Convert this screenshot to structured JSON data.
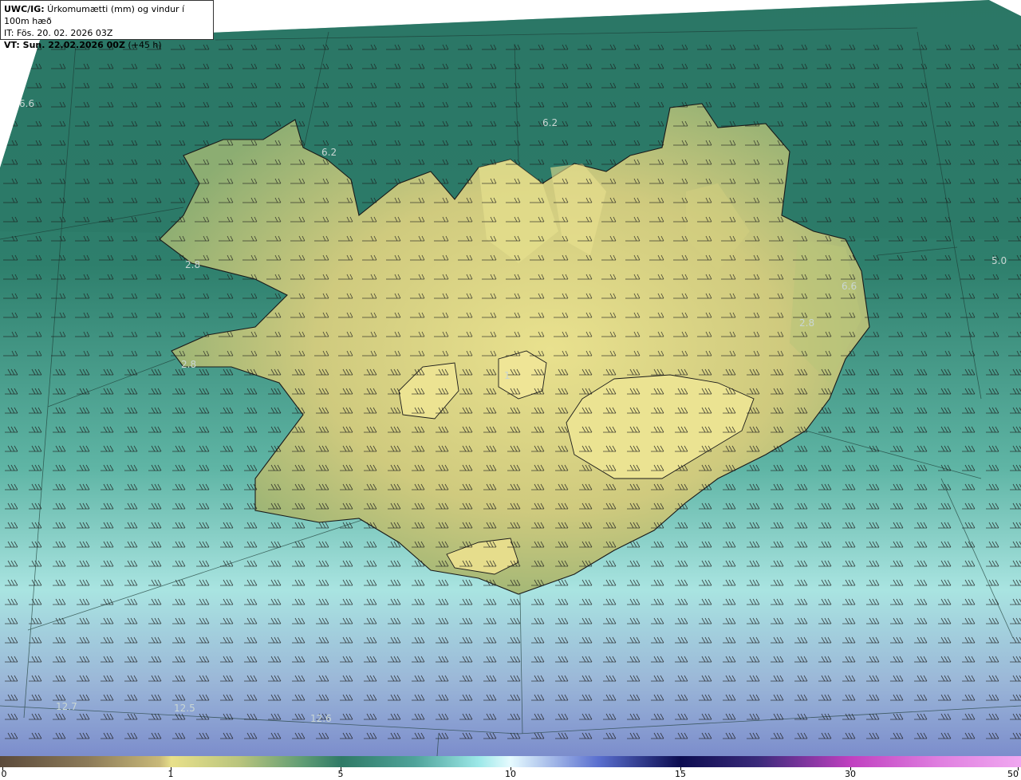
{
  "header": {
    "line1_prefix": "UWC/IG:",
    "line1_text": " Úrkomumætti (mm) og vindur í 100m hæð",
    "line2": "IT: Fös. 20. 02. 2026 03Z",
    "line3_prefix": "VT: Sun. 22.02.2026 00Z",
    "line3_text": " (+45 h)"
  },
  "map_labels": [
    {
      "id": "label-w-top",
      "text": "6.6"
    },
    {
      "id": "label-westfjords",
      "text": "6.2"
    },
    {
      "id": "label-north",
      "text": "6.2"
    },
    {
      "id": "label-east-sea",
      "text": "5.0"
    },
    {
      "id": "label-east-coast",
      "text": "6.6"
    },
    {
      "id": "label-east-inland",
      "text": "2.8"
    },
    {
      "id": "label-west-inland",
      "text": "2.8"
    },
    {
      "id": "label-snaefells",
      "text": "2.8"
    },
    {
      "id": "label-center",
      "text": "1"
    },
    {
      "id": "label-sw-sea",
      "text": "12.7"
    },
    {
      "id": "label-s-sea-1",
      "text": "12.5"
    },
    {
      "id": "label-s-sea-2",
      "text": "12.6"
    }
  ],
  "colorbar": {
    "ticks": [
      "0",
      "1",
      "5",
      "10",
      "15",
      "30",
      "50"
    ],
    "colors": [
      "#5b4a3b",
      "#b0a070",
      "#e8e08a",
      "#2f7a66",
      "#9ce8e8",
      "#e6fbff",
      "#2a2a8a",
      "#0c0c50",
      "#c040c0",
      "#f0a8f0"
    ]
  },
  "colors": {
    "sea_north": "#2e7c6a",
    "sea_south": "#a6dfe0",
    "land": "#c8c87a",
    "land_light": "#e6e08c"
  }
}
